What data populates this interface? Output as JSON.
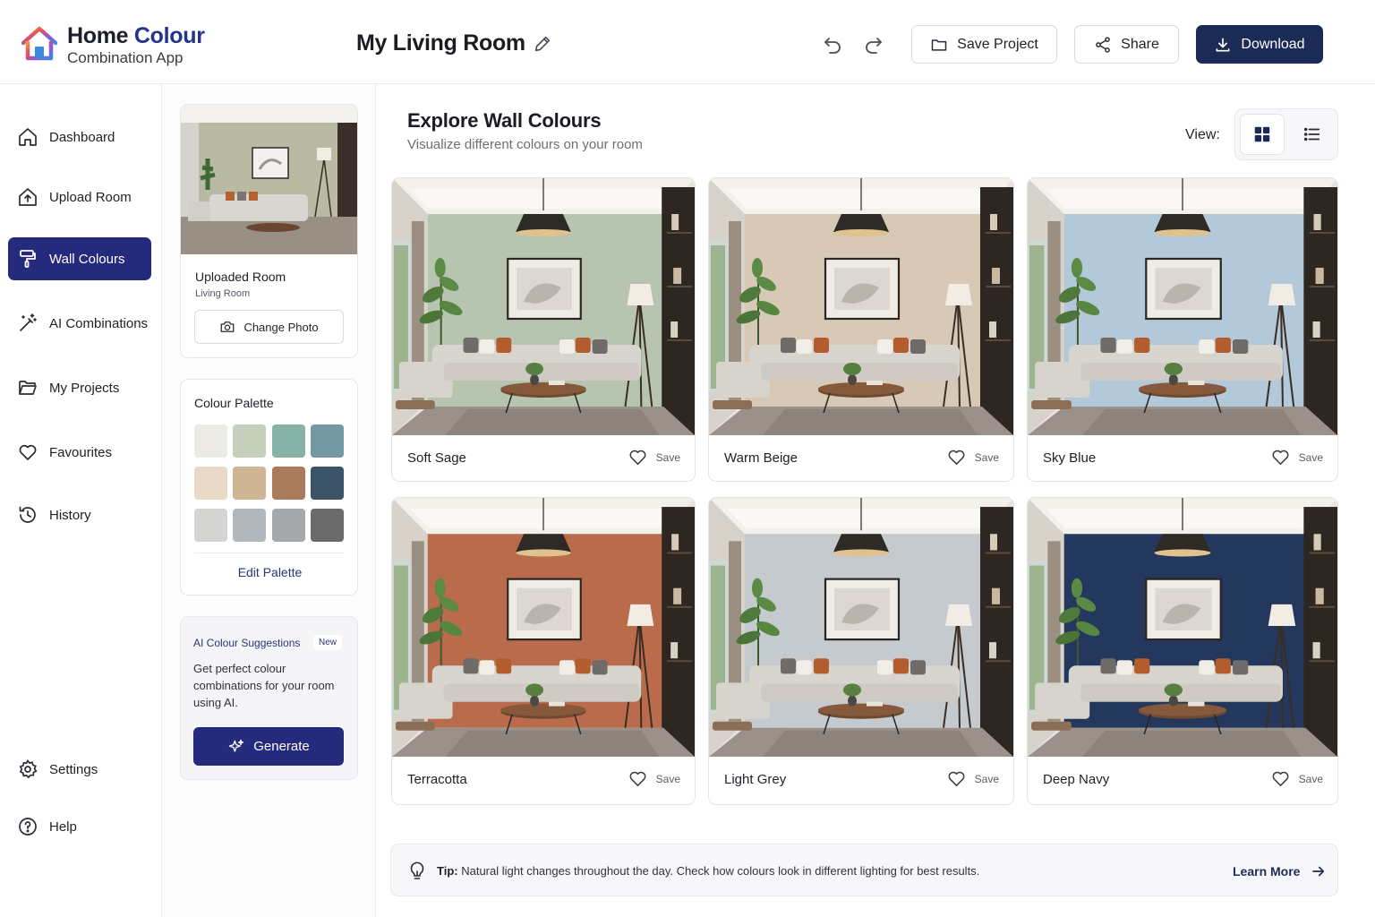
{
  "app": {
    "brand_line1_a": "Home",
    "brand_line1_b": "Colour",
    "brand_line2": "Combination App",
    "project_title": "My Living Room"
  },
  "header_buttons": {
    "save": "Save Project",
    "share": "Share",
    "download": "Download"
  },
  "sidebar": {
    "items": [
      {
        "label": "Dashboard",
        "icon": "home-icon"
      },
      {
        "label": "Upload Room",
        "icon": "upload-icon"
      },
      {
        "label": "Wall Colours",
        "icon": "paint-roller-icon",
        "active": true
      },
      {
        "label": "AI Combinations",
        "icon": "magic-wand-icon"
      },
      {
        "label": "My Projects",
        "icon": "folder-icon"
      },
      {
        "label": "Favourites",
        "icon": "heart-icon"
      },
      {
        "label": "History",
        "icon": "history-icon"
      }
    ],
    "bottom": [
      {
        "label": "Settings",
        "icon": "gear-icon"
      },
      {
        "label": "Help",
        "icon": "help-icon"
      }
    ]
  },
  "upload_card": {
    "title": "Uploaded Room",
    "subtitle": "Living Room",
    "change_button": "Change Photo"
  },
  "palette": {
    "title": "Colour Palette",
    "colors": [
      "#ecebe6",
      "#c5cfb9",
      "#86b3a6",
      "#7498a4",
      "#e8dac7",
      "#cfb593",
      "#a97b5c",
      "#3b5468",
      "#d4d4d3",
      "#b1b7bb",
      "#a6a9ab",
      "#6b6b6b"
    ],
    "edit_label": "Edit Palette"
  },
  "ai_card": {
    "title": "AI Colour Suggestions",
    "badge": "New",
    "description": "Get perfect colour combinations for your room using AI.",
    "button": "Generate"
  },
  "main": {
    "title": "Explore Wall Colours",
    "subtitle": "Visualize different colours on your room",
    "view_label": "View:",
    "save_label": "Save",
    "rooms": [
      {
        "name": "Soft Sage",
        "wall": "#b7c4b0"
      },
      {
        "name": "Warm Beige",
        "wall": "#d7c9b6"
      },
      {
        "name": "Sky Blue",
        "wall": "#b3c8d9"
      },
      {
        "name": "Terracotta",
        "wall": "#b96b4c"
      },
      {
        "name": "Light Grey",
        "wall": "#c5cace"
      },
      {
        "name": "Deep Navy",
        "wall": "#24375c"
      }
    ]
  },
  "tip": {
    "label": "Tip:",
    "text": "Natural light changes throughout the day. Check how colours look in different lighting for best results.",
    "link": "Learn More"
  }
}
